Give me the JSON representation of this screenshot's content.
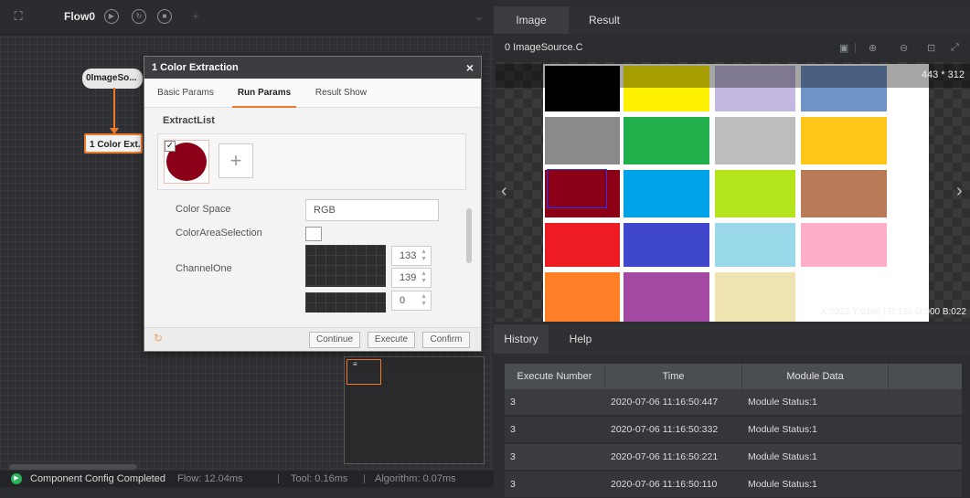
{
  "flow": {
    "name": "Flow0",
    "add_icon": "+",
    "nodes": [
      {
        "label": "0ImageSo..."
      },
      {
        "label": "1 Color Ext..."
      }
    ]
  },
  "status": {
    "message": "Component Config Completed",
    "flow": "Flow: 12.04ms",
    "tool": "Tool: 0.16ms",
    "algorithm": "Algorithm: 0.07ms"
  },
  "dialog": {
    "title": "1 Color Extraction",
    "close": "×",
    "tabs": [
      "Basic Params",
      "Run Params",
      "Result Show"
    ],
    "active_tab": "Run Params",
    "extract_list_label": "ExtractList",
    "extract_color": "#8b0016",
    "add_label": "+",
    "params": {
      "color_space_label": "Color Space",
      "color_space_value": "RGB",
      "area_selection_label": "ColorAreaSelection",
      "channel_one_label": "ChannelOne",
      "channel_one_min": "133",
      "channel_one_max": "139",
      "channel_two_min": "0"
    },
    "buttons": {
      "continue": "Continue",
      "execute": "Execute",
      "confirm": "Confirm"
    }
  },
  "image_panel": {
    "tabs": [
      "Image",
      "Result"
    ],
    "active_tab": "Image",
    "source": "0 ImageSource.C",
    "image_size": "443 * 312",
    "pixel_info": "X:0012 Y:0186 | R:136 G:000 B:022",
    "swatches": [
      "#000000",
      "#fff200",
      "#c4b8e0",
      "#6f93c4",
      "#8a8a8a",
      "#22b04c",
      "#bdbdbd",
      "#ffc61a",
      "#8b0016",
      "#00a2e8",
      "#b5e61d",
      "#b97a57",
      "#ed1c24",
      "#3f48cc",
      "#99d9ea",
      "#ffaec9",
      "#ff7f27",
      "#a349a4",
      "#efe4b0",
      "#ffffff"
    ]
  },
  "history": {
    "tabs": [
      "History",
      "Help"
    ],
    "active_tab": "History",
    "columns": [
      "Execute Number",
      "Time",
      "Module Data"
    ],
    "rows": [
      {
        "num": "3",
        "time": "2020-07-06 11:16:50:447",
        "data": "Module Status:1"
      },
      {
        "num": "3",
        "time": "2020-07-06 11:16:50:332",
        "data": "Module Status:1"
      },
      {
        "num": "3",
        "time": "2020-07-06 11:16:50:221",
        "data": "Module Status:1"
      },
      {
        "num": "3",
        "time": "2020-07-06 11:16:50:110",
        "data": "Module Status:1"
      }
    ]
  }
}
